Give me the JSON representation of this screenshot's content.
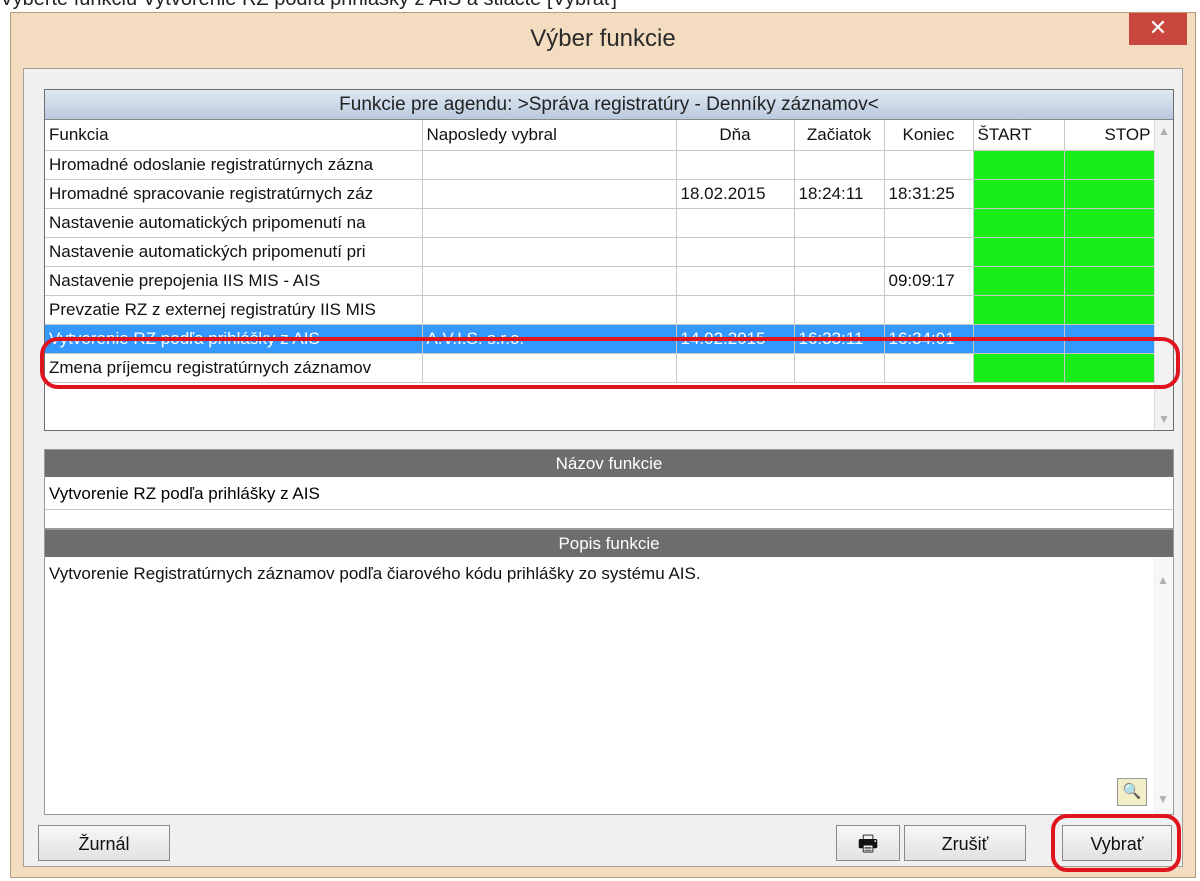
{
  "page_caption": "Vyberte funkciu Vytvorenie RZ podľa prihlášky z AIS a stlačte [Vybrať]",
  "window": {
    "title": "Výber funkcie",
    "close_glyph": "✕"
  },
  "grid": {
    "caption": "Funkcie pre agendu: >Správa registratúry - Denníky záznamov<",
    "columns": [
      "Funkcia",
      "Naposledy vybral",
      "Dňa",
      "Začiatok",
      "Koniec",
      "ŠTART",
      "STOP"
    ],
    "rows": [
      [
        "Hromadné odoslanie registratúrnych zázna",
        "",
        "",
        "",
        "",
        "",
        ""
      ],
      [
        "Hromadné spracovanie registratúrnych záz",
        "",
        "18.02.2015",
        "18:24:11",
        "18:31:25",
        "",
        ""
      ],
      [
        "Nastavenie automatických pripomenutí na",
        "",
        "",
        "",
        "",
        "",
        ""
      ],
      [
        "Nastavenie automatických pripomenutí pri",
        "",
        "",
        "",
        "",
        "",
        ""
      ],
      [
        "Nastavenie prepojenia IIS MIS - AIS",
        "",
        "",
        "",
        "09:09:17",
        "",
        ""
      ],
      [
        "Prevzatie RZ z externej registratúry IIS MIS",
        "",
        "",
        "",
        "",
        "",
        ""
      ],
      [
        "Vytvorenie RZ podľa prihlášky z AIS",
        "A.V.I.S. s.r.o.",
        "14.02.2015",
        "16:33:11",
        "16:34:01",
        "",
        ""
      ],
      [
        "Zmena príjemcu registratúrnych záznamov",
        "",
        "",
        "",
        "",
        "",
        ""
      ]
    ],
    "selected_row_index": 6
  },
  "name_section": {
    "header": "Názov funkcie",
    "value": "Vytvorenie RZ podľa prihlášky z AIS"
  },
  "desc_section": {
    "header": "Popis funkcie",
    "text": "Vytvorenie Registratúrnych záznamov podľa čiarového kódu prihlášky zo systému AIS."
  },
  "buttons": {
    "journal": "Žurnál",
    "print_glyph": "🖶",
    "cancel": "Zrušiť",
    "select": "Vybrať"
  },
  "colors": {
    "highlight": "#3399ff",
    "green": "#1aee1a",
    "annotation": "#e0141e"
  }
}
